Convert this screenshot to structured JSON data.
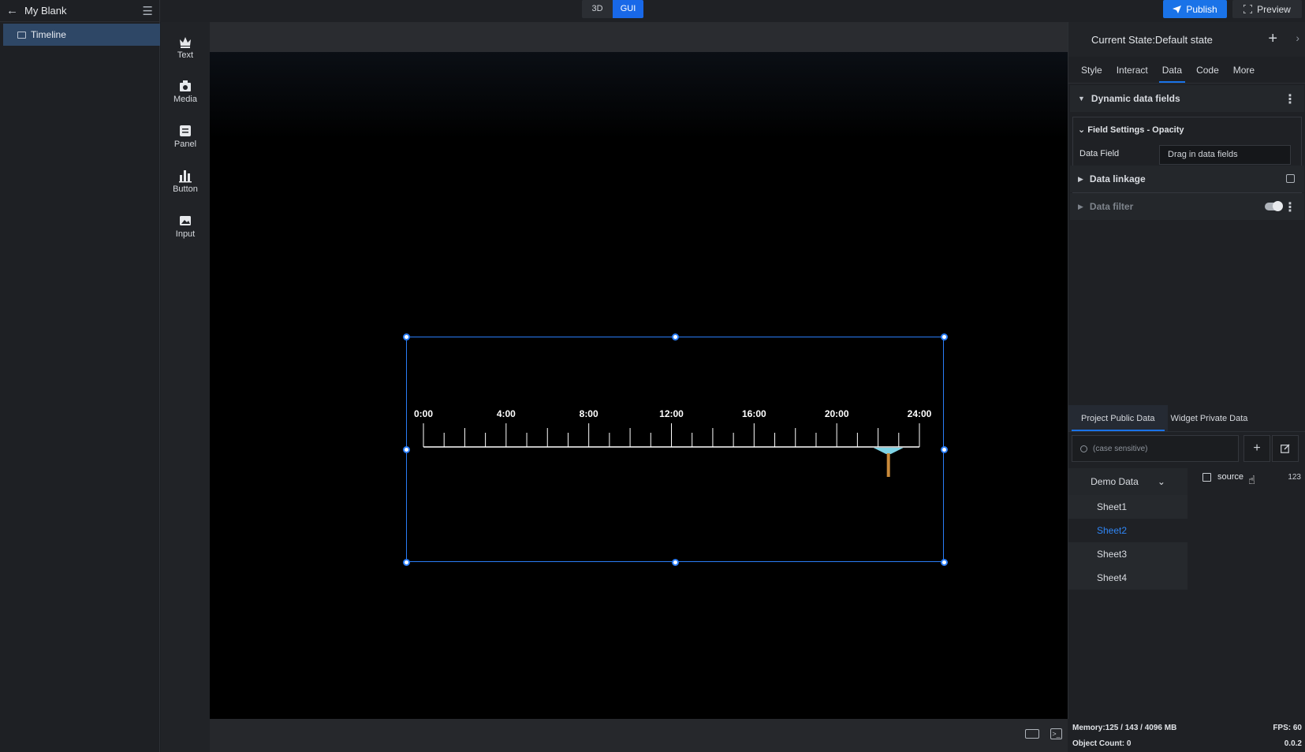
{
  "app": {
    "project_title": "My Blank"
  },
  "layers": [
    {
      "label": "Timeline"
    }
  ],
  "toolbox": [
    {
      "label": "Text",
      "icon": "text-icon"
    },
    {
      "label": "Media",
      "icon": "media-icon"
    },
    {
      "label": "Panel",
      "icon": "panel-icon"
    },
    {
      "label": "Button",
      "icon": "button-icon"
    },
    {
      "label": "Input",
      "icon": "input-icon"
    }
  ],
  "mode_switch": {
    "options": [
      "3D",
      "GUI"
    ],
    "active": "GUI"
  },
  "header": {
    "publish_label": "Publish",
    "preview_label": "Preview"
  },
  "widget": {
    "tick_labels": [
      "0:00",
      "4:00",
      "8:00",
      "12:00",
      "16:00",
      "20:00",
      "24:00"
    ],
    "minor_ticks_per_major": 4,
    "current_time_hours": 22.5,
    "range_hours": [
      0,
      24
    ],
    "colors": {
      "ticks": "#ffffff",
      "marker_head": "#7fd4e6",
      "marker_stem": "#c98a3a",
      "selection": "#2a7df7"
    }
  },
  "right_panel": {
    "state_label": "Current State:Default state",
    "tabs": [
      "Style",
      "Interact",
      "Data",
      "Code",
      "More"
    ],
    "active_tab": "Data",
    "dynamic_fields_title": "Dynamic data fields",
    "field_settings_title": "Field Settings - Opacity",
    "data_field_label": "Data Field",
    "data_field_value": "Drag in data fields",
    "data_linkage_title": "Data linkage",
    "data_filter_title": "Data filter",
    "data_tabs": [
      "Project Public Data",
      "Widget Private Data"
    ],
    "search_placeholder": "(case sensitive)",
    "dataset": "Demo Data",
    "sheets": [
      "Sheet1",
      "Sheet2",
      "Sheet3",
      "Sheet4"
    ],
    "selected_sheet": "Sheet2",
    "field": {
      "name": "source",
      "type": "123"
    }
  },
  "status": {
    "memory": "Memory:125 / 143 / 4096 MB",
    "fps": "FPS: 60",
    "object_count": "Object Count: 0",
    "version": "0.0.2"
  }
}
